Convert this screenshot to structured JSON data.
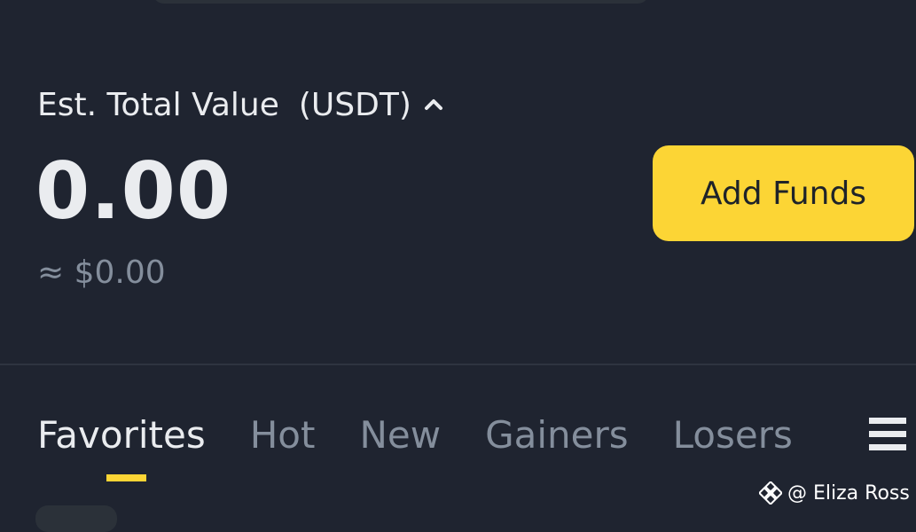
{
  "portfolio": {
    "est_label": "Est. Total Value",
    "est_unit": "(USDT)",
    "balance": "0.00",
    "fiat_equivalent": "≈ $0.00",
    "toggle_icon": "chevron-up-icon"
  },
  "actions": {
    "add_funds_label": "Add Funds"
  },
  "market_tabs": [
    {
      "label": "Favorites",
      "active": true
    },
    {
      "label": "Hot",
      "active": false
    },
    {
      "label": "New",
      "active": false
    },
    {
      "label": "Gainers",
      "active": false
    },
    {
      "label": "Losers",
      "active": false
    }
  ],
  "menu_icon": "hamburger-menu-icon",
  "watermark": {
    "text": "@ Eliza Ross",
    "icon": "binance-logo-icon"
  },
  "colors": {
    "background": "#1f2430",
    "accent": "#fcd535",
    "text_primary": "#eaecef",
    "text_secondary": "#848e9c"
  }
}
